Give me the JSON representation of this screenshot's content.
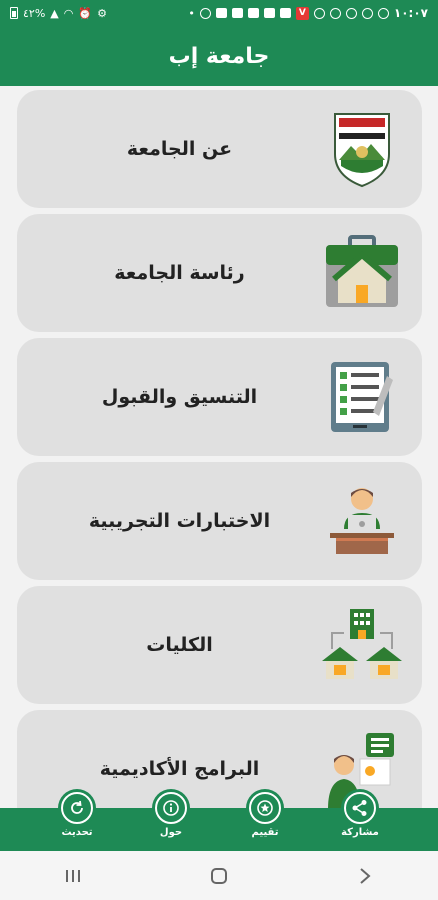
{
  "status_bar": {
    "time": "١٠:٠٧",
    "battery": "٤٢%"
  },
  "app_bar": {
    "title": "جامعة إب"
  },
  "menu": [
    {
      "label": "عن الجامعة",
      "icon": "university-logo-icon"
    },
    {
      "label": "رئاسة الجامعة",
      "icon": "house-briefcase-icon"
    },
    {
      "label": "التنسيق والقبول",
      "icon": "checklist-tablet-icon"
    },
    {
      "label": "الاختبارات التجريبية",
      "icon": "student-laptop-icon"
    },
    {
      "label": "الكليات",
      "icon": "buildings-network-icon"
    },
    {
      "label": "البرامج الأكاديمية",
      "icon": "teacher-board-icon"
    }
  ],
  "bottom_nav": {
    "share": "مشاركة",
    "rate": "تقييم",
    "about": "حول",
    "update": "تحديث"
  },
  "colors": {
    "primary": "#1e8a55",
    "card": "#e0e0e0"
  }
}
